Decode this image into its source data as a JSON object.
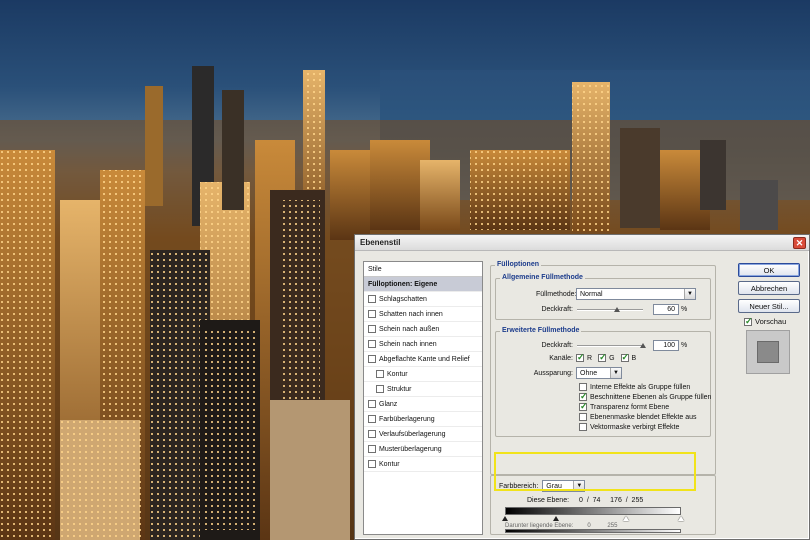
{
  "dialog": {
    "title": "Ebenenstil",
    "close_glyph": "✕"
  },
  "stylelist": {
    "header": "Stile",
    "items": [
      {
        "label": "Fülloptionen: Eigene",
        "checkbox": false,
        "checked": false,
        "selected": true,
        "sub": false
      },
      {
        "label": "Schlagschatten",
        "checkbox": true,
        "checked": false,
        "selected": false,
        "sub": false
      },
      {
        "label": "Schatten nach innen",
        "checkbox": true,
        "checked": false,
        "selected": false,
        "sub": false
      },
      {
        "label": "Schein nach außen",
        "checkbox": true,
        "checked": false,
        "selected": false,
        "sub": false
      },
      {
        "label": "Schein nach innen",
        "checkbox": true,
        "checked": false,
        "selected": false,
        "sub": false
      },
      {
        "label": "Abgeflachte Kante und Relief",
        "checkbox": true,
        "checked": false,
        "selected": false,
        "sub": false
      },
      {
        "label": "Kontur",
        "checkbox": true,
        "checked": false,
        "selected": false,
        "sub": true
      },
      {
        "label": "Struktur",
        "checkbox": true,
        "checked": false,
        "selected": false,
        "sub": true
      },
      {
        "label": "Glanz",
        "checkbox": true,
        "checked": false,
        "selected": false,
        "sub": false
      },
      {
        "label": "Farbüberlagerung",
        "checkbox": true,
        "checked": false,
        "selected": false,
        "sub": false
      },
      {
        "label": "Verlaufsüberlagerung",
        "checkbox": true,
        "checked": false,
        "selected": false,
        "sub": false
      },
      {
        "label": "Musterüberlagerung",
        "checkbox": true,
        "checked": false,
        "selected": false,
        "sub": false
      },
      {
        "label": "Kontur",
        "checkbox": true,
        "checked": false,
        "selected": false,
        "sub": false
      }
    ]
  },
  "fill": {
    "section_title": "Fülloptionen",
    "general": {
      "title": "Allgemeine Füllmethode",
      "blend_label": "Füllmethode:",
      "blend_value": "Normal",
      "opacity_label": "Deckkraft:",
      "opacity_value": "60",
      "opacity_unit": "%",
      "opacity_fraction": 0.6
    },
    "advanced": {
      "title": "Erweiterte Füllmethode",
      "fill_label": "Deckkraft:",
      "fill_value": "100",
      "fill_unit": "%",
      "fill_fraction": 1.0,
      "channels_label": "Kanäle:",
      "channels": [
        {
          "label": "R",
          "checked": true
        },
        {
          "label": "G",
          "checked": true
        },
        {
          "label": "B",
          "checked": true
        }
      ],
      "knockout_label": "Aussparung:",
      "knockout_value": "Ohne",
      "options": [
        {
          "label": "Interne Effekte als Gruppe füllen",
          "checked": false
        },
        {
          "label": "Beschnittene Ebenen als Gruppe füllen",
          "checked": true
        },
        {
          "label": "Transparenz formt Ebene",
          "checked": true
        },
        {
          "label": "Ebenenmaske blendet Effekte aus",
          "checked": false
        },
        {
          "label": "Vektormaske verbirgt Effekte",
          "checked": false
        }
      ]
    },
    "blend_if": {
      "label": "Farbbereich:",
      "value": "Grau",
      "this_layer_label": "Diese Ebene:",
      "this_layer_values": "0  /  74     176  /  255",
      "underlying_label": "Darunter liegende Ebene:",
      "underlying_values": "0          255"
    }
  },
  "buttons": {
    "ok": "OK",
    "cancel": "Abbrechen",
    "new_style": "Neuer Stil...",
    "preview_label": "Vorschau",
    "preview_checked": true
  },
  "colors": {
    "highlight": "#f1e31a",
    "group_title": "#1c3c8c",
    "selected_item": "#c8cbd6"
  }
}
